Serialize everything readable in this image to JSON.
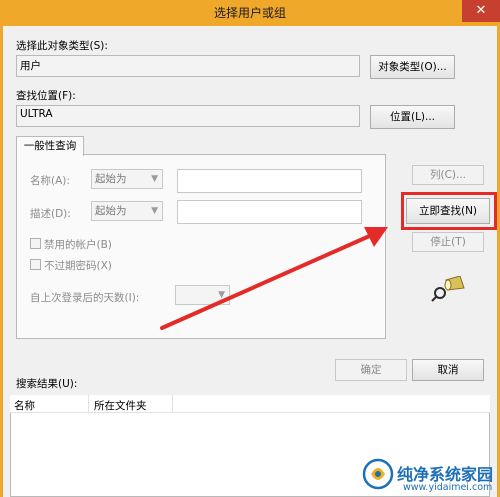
{
  "window": {
    "title": "选择用户或组",
    "close_glyph": "✕"
  },
  "object_type": {
    "label": "选择此对象类型(S):",
    "value": "用户",
    "button": "对象类型(O)..."
  },
  "location": {
    "label": "查找位置(F):",
    "value": "ULTRA",
    "button": "位置(L)..."
  },
  "tab": {
    "label": "一般性查询"
  },
  "query": {
    "name_label": "名称(A):",
    "name_mode": "起始为",
    "desc_label": "描述(D):",
    "desc_mode": "起始为",
    "disabled_accounts": "禁用的帐户(B)",
    "non_expiring": "不过期密码(X)",
    "days_label": "自上次登录后的天数(I):"
  },
  "side_buttons": {
    "columns": "列(C)...",
    "find_now": "立即查找(N)",
    "stop": "停止(T)"
  },
  "dialog_buttons": {
    "ok": "确定",
    "cancel": "取消"
  },
  "results": {
    "label": "搜索结果(U):",
    "columns": [
      "名称",
      "所在文件夹"
    ]
  },
  "watermark": {
    "brand": "纯净系统家园",
    "url": "www.yidaimei.com"
  },
  "colors": {
    "title_bar": "#f0a82a",
    "close": "#c7402f",
    "annotation": "#e52b28",
    "watermark": "#1d6fb8"
  },
  "icons": {
    "search_icon": "flashlight-search-icon",
    "arrow": "red-annotation-arrow"
  }
}
